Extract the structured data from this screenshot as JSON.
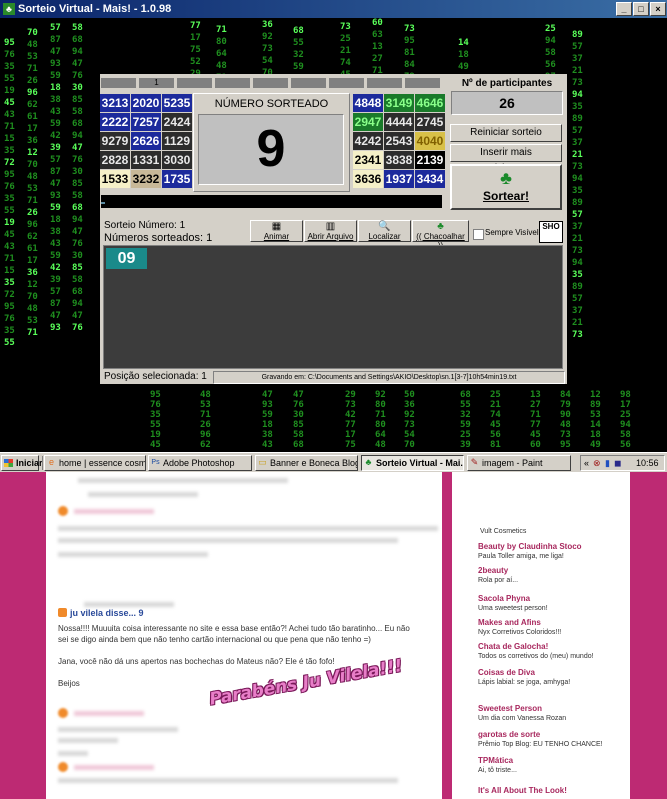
{
  "window": {
    "title": "Sorteio Virtual - Mais! - 1.0.98",
    "buttons": [
      "_",
      "□",
      "×"
    ]
  },
  "matrix_columns": [
    {
      "lines": [
        "95",
        "76",
        "35",
        "55",
        "19",
        "45",
        "43",
        "71",
        "15",
        "35",
        "72"
      ]
    },
    {
      "lines": [
        "70",
        "48",
        "53",
        "71",
        "26",
        "96",
        "62",
        "61",
        "17",
        "36",
        "12"
      ]
    },
    {
      "lines": [
        "57",
        "87",
        "47",
        "93",
        "59",
        "18",
        "38",
        "43",
        "59",
        "42",
        "39"
      ]
    },
    {
      "lines": [
        "58",
        "68",
        "94",
        "47",
        "76",
        "30",
        "85"
      ]
    },
    {
      "lines": [
        "77",
        "17",
        "75",
        "52",
        "29",
        "73",
        "42"
      ]
    },
    {
      "lines": [
        "71",
        "80",
        "64",
        "48",
        "71",
        "92",
        "80"
      ]
    },
    {
      "lines": [
        "36",
        "92",
        "73",
        "54",
        "70",
        "31",
        "50"
      ]
    },
    {
      "lines": [
        "68",
        "55",
        "32",
        "59",
        "25",
        "39",
        "69"
      ]
    },
    {
      "lines": [
        "73",
        "25",
        "21",
        "74",
        "45",
        "56",
        "81"
      ]
    },
    {
      "lines": [
        "60",
        "63",
        "13",
        "27",
        "71",
        "77",
        "45"
      ]
    },
    {
      "lines": [
        "73",
        "95",
        "81",
        "84",
        "79",
        "90",
        "48"
      ]
    },
    {
      "lines": [
        "14",
        "18",
        "49",
        "26",
        "12",
        "89",
        "53"
      ]
    },
    {
      "lines": [
        "25",
        "94",
        "58",
        "56",
        "97",
        "98",
        "17"
      ]
    },
    {
      "lines": [
        "89",
        "57",
        "37",
        "21",
        "73",
        "94",
        "35"
      ]
    }
  ],
  "grid_header": {
    "cells": [
      "",
      "1",
      "",
      "",
      "",
      "",
      "",
      "",
      ""
    ]
  },
  "number_grid_left": [
    [
      {
        "n": "3213",
        "c": "blue"
      },
      {
        "n": "2020",
        "c": "blue"
      },
      {
        "n": "5235",
        "c": "blue"
      }
    ],
    [
      {
        "n": "2222",
        "c": "blue"
      },
      {
        "n": "7257",
        "c": "blue"
      },
      {
        "n": "2424",
        "c": "dark"
      }
    ],
    [
      {
        "n": "9279",
        "c": "dark"
      },
      {
        "n": "2626",
        "c": "blue"
      },
      {
        "n": "1129",
        "c": "dark"
      }
    ],
    [
      {
        "n": "2828",
        "c": "dark"
      },
      {
        "n": "1331",
        "c": "dark"
      },
      {
        "n": "3030",
        "c": "dark"
      }
    ],
    [
      {
        "n": "1533",
        "c": "cream"
      },
      {
        "n": "3232",
        "c": "tan"
      },
      {
        "n": "1735",
        "c": "blue"
      }
    ]
  ],
  "number_grid_right": [
    [
      {
        "n": "4848",
        "c": "blue"
      },
      {
        "n": "3149",
        "c": "green"
      },
      {
        "n": "4646",
        "c": "green"
      }
    ],
    [
      {
        "n": "2947",
        "c": "green"
      },
      {
        "n": "4444",
        "c": "dark"
      },
      {
        "n": "2745",
        "c": "dark"
      }
    ],
    [
      {
        "n": "4242",
        "c": "dark"
      },
      {
        "n": "2543",
        "c": "dark"
      },
      {
        "n": "4040",
        "c": "gold"
      }
    ],
    [
      {
        "n": "2341",
        "c": "cream"
      },
      {
        "n": "3838",
        "c": "dark"
      },
      {
        "n": "2139"
      }
    ],
    [
      {
        "n": "3636",
        "c": "cream"
      },
      {
        "n": "1937",
        "c": "blue"
      },
      {
        "n": "3434",
        "c": "blue"
      }
    ]
  ],
  "cell_colors": {
    "blue": "#1c2a9c",
    "dark": "#2c2c2c",
    "green": "#1a7a2a",
    "cream": "#f5f0c8",
    "tan": "#c8b898",
    "gold": "#d8c048"
  },
  "drawn": {
    "label": "NÚMERO SORTEADO",
    "value": "9"
  },
  "participants": {
    "label": "Nº de participantes",
    "value": "26"
  },
  "controls": {
    "restart": "Reiniciar sorteio",
    "add": "Inserir mais participantes",
    "draw": "Sortear!",
    "draw_icon": "♣"
  },
  "info": {
    "sorteio": "Sorteio Número: 1",
    "sorteados": "Números sorteados: 1",
    "posicao": "Posição selecionada: 1"
  },
  "toolbar": [
    {
      "name": "animar",
      "label": "Animar",
      "icon": "▦"
    },
    {
      "name": "abrir-arquivo",
      "label": "Abrir Arquivo",
      "icon": "▥"
    },
    {
      "name": "localizar",
      "label": "Localizar",
      "icon": "🔍"
    },
    {
      "name": "chacoalhar",
      "label": "(( Chacoalhar ))",
      "icon": "♣"
    }
  ],
  "sempre_visivel": "Sempre Visível",
  "sho_logo": "SHO",
  "drawn_numbers": [
    "09"
  ],
  "status": "Gravando em: C:\\Documents and Settings\\AKIO\\Desktop\\sn.1[3-7]10h54min19.txt",
  "taskbar": {
    "start": "Iniciar",
    "tasks": [
      {
        "label": "home | essence cosmetic...",
        "icon": "e"
      },
      {
        "label": "Adobe Photoshop",
        "icon": "Ps"
      },
      {
        "label": "Banner e Boneca Blog",
        "icon": "▭"
      },
      {
        "label": "Sorteio Virtual - Mai...",
        "icon": "♣"
      },
      {
        "label": "imagem - Paint",
        "icon": "✎"
      }
    ],
    "tray_icons": [
      "«",
      "⊗",
      "▮",
      "◼"
    ],
    "time": "10:56"
  },
  "blog": {
    "comment_header": "ju vilela disse... 9",
    "comment_lines": [
      "Nossa!!!! Muuuita coisa interessante no site e essa base então?! Achei tudo tão baratinho... Eu não",
      "sei se digo ainda bem que não tenho cartão internacional ou que pena que não tenho =)",
      "",
      "Jana, você não dá uns apertos nas bochechas do Mateus não? Ele é tão fofo!",
      "",
      "Beijos"
    ],
    "overlay": "Parabéns Ju Vilela!!!",
    "sidebar_top": "Vult Cosmetics",
    "sidebar": [
      {
        "title": "Beauty by Claudinha Stoco",
        "sub": "Paula Toller amiga, me liga!"
      },
      {
        "title": "2beauty",
        "sub": "Rola por aí..."
      },
      {
        "title": "Sacola Phyna",
        "sub": "Uma sweetest person!"
      },
      {
        "title": "Makes and Afins",
        "sub": "Nyx Corretivos Coloridos!!!"
      },
      {
        "title": "Chata de Galocha!",
        "sub": "Todos os corretivos do (meu) mundo!"
      },
      {
        "title": "Coisas de Diva",
        "sub": "Lápis labial: se joga, amhyga!"
      },
      {
        "title": "Sweetest Person",
        "sub": "Um dia com Vanessa Rozan"
      },
      {
        "title": "garotas de sorte",
        "sub": "Prêmio Top Blog: EU TENHO CHANCE!"
      },
      {
        "title": "TPMática",
        "sub": "Ai, tô triste..."
      },
      {
        "title": "It's All About The Look!",
        "sub": ""
      }
    ]
  }
}
